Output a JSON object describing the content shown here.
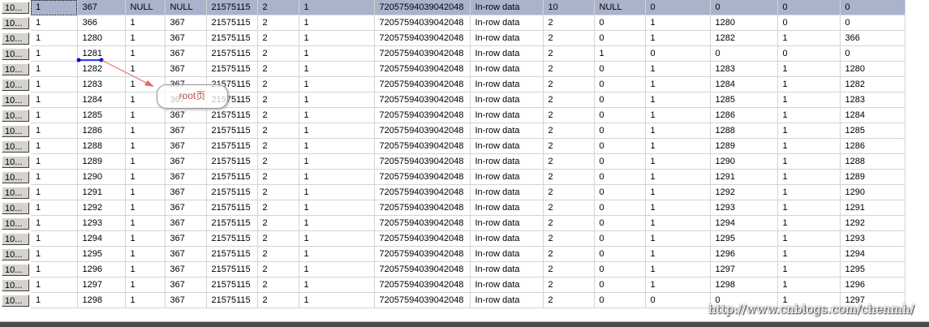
{
  "row_header_label": "10...",
  "rows": [
    [
      "1",
      "367",
      "NULL",
      "NULL",
      "21575115",
      "2",
      "1",
      "72057594039042048",
      "In-row data",
      "10",
      "NULL",
      "0",
      "0",
      "0",
      "0"
    ],
    [
      "1",
      "366",
      "1",
      "367",
      "21575115",
      "2",
      "1",
      "72057594039042048",
      "In-row data",
      "2",
      "0",
      "1",
      "1280",
      "0",
      "0"
    ],
    [
      "1",
      "1280",
      "1",
      "367",
      "21575115",
      "2",
      "1",
      "72057594039042048",
      "In-row data",
      "2",
      "0",
      "1",
      "1282",
      "1",
      "366"
    ],
    [
      "1",
      "1281",
      "1",
      "367",
      "21575115",
      "2",
      "1",
      "72057594039042048",
      "In-row data",
      "2",
      "1",
      "0",
      "0",
      "0",
      "0"
    ],
    [
      "1",
      "1282",
      "1",
      "367",
      "21575115",
      "2",
      "1",
      "72057594039042048",
      "In-row data",
      "2",
      "0",
      "1",
      "1283",
      "1",
      "1280"
    ],
    [
      "1",
      "1283",
      "1",
      "367",
      "21575115",
      "2",
      "1",
      "72057594039042048",
      "In-row data",
      "2",
      "0",
      "1",
      "1284",
      "1",
      "1282"
    ],
    [
      "1",
      "1284",
      "1",
      "367",
      "21575115",
      "2",
      "1",
      "72057594039042048",
      "In-row data",
      "2",
      "0",
      "1",
      "1285",
      "1",
      "1283"
    ],
    [
      "1",
      "1285",
      "1",
      "367",
      "21575115",
      "2",
      "1",
      "72057594039042048",
      "In-row data",
      "2",
      "0",
      "1",
      "1286",
      "1",
      "1284"
    ],
    [
      "1",
      "1286",
      "1",
      "367",
      "21575115",
      "2",
      "1",
      "72057594039042048",
      "In-row data",
      "2",
      "0",
      "1",
      "1288",
      "1",
      "1285"
    ],
    [
      "1",
      "1288",
      "1",
      "367",
      "21575115",
      "2",
      "1",
      "72057594039042048",
      "In-row data",
      "2",
      "0",
      "1",
      "1289",
      "1",
      "1286"
    ],
    [
      "1",
      "1289",
      "1",
      "367",
      "21575115",
      "2",
      "1",
      "72057594039042048",
      "In-row data",
      "2",
      "0",
      "1",
      "1290",
      "1",
      "1288"
    ],
    [
      "1",
      "1290",
      "1",
      "367",
      "21575115",
      "2",
      "1",
      "72057594039042048",
      "In-row data",
      "2",
      "0",
      "1",
      "1291",
      "1",
      "1289"
    ],
    [
      "1",
      "1291",
      "1",
      "367",
      "21575115",
      "2",
      "1",
      "72057594039042048",
      "In-row data",
      "2",
      "0",
      "1",
      "1292",
      "1",
      "1290"
    ],
    [
      "1",
      "1292",
      "1",
      "367",
      "21575115",
      "2",
      "1",
      "72057594039042048",
      "In-row data",
      "2",
      "0",
      "1",
      "1293",
      "1",
      "1291"
    ],
    [
      "1",
      "1293",
      "1",
      "367",
      "21575115",
      "2",
      "1",
      "72057594039042048",
      "In-row data",
      "2",
      "0",
      "1",
      "1294",
      "1",
      "1292"
    ],
    [
      "1",
      "1294",
      "1",
      "367",
      "21575115",
      "2",
      "1",
      "72057594039042048",
      "In-row data",
      "2",
      "0",
      "1",
      "1295",
      "1",
      "1293"
    ],
    [
      "1",
      "1295",
      "1",
      "367",
      "21575115",
      "2",
      "1",
      "72057594039042048",
      "In-row data",
      "2",
      "0",
      "1",
      "1296",
      "1",
      "1294"
    ],
    [
      "1",
      "1296",
      "1",
      "367",
      "21575115",
      "2",
      "1",
      "72057594039042048",
      "In-row data",
      "2",
      "0",
      "1",
      "1297",
      "1",
      "1295"
    ],
    [
      "1",
      "1297",
      "1",
      "367",
      "21575115",
      "2",
      "1",
      "72057594039042048",
      "In-row data",
      "2",
      "0",
      "1",
      "1298",
      "1",
      "1296"
    ],
    [
      "1",
      "1298",
      "1",
      "367",
      "21575115",
      "2",
      "1",
      "72057594039042048",
      "In-row data",
      "2",
      "0",
      "0",
      "0",
      "1",
      "1297"
    ]
  ],
  "annotation": {
    "callout_text": "root页",
    "arrow_color": "#e06666",
    "marker_color": "#0000dd"
  },
  "watermark": "http://www.cnblogs.com/chenmh/"
}
